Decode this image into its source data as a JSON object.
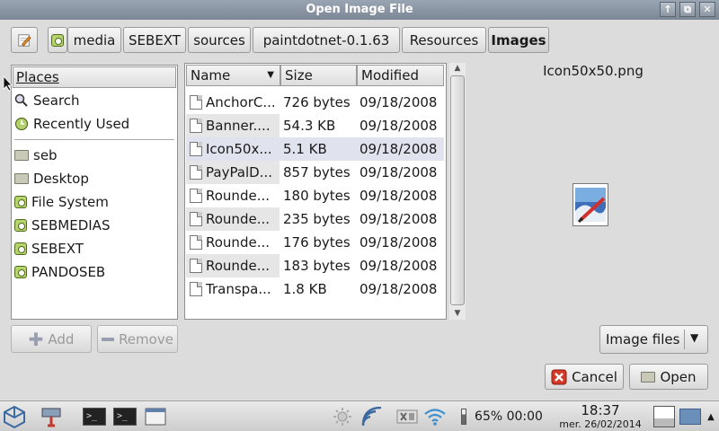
{
  "window": {
    "title": "Open Image File",
    "controls": [
      "↑",
      "⧉",
      "✕"
    ]
  },
  "path": {
    "edit_icon": "pencil-icon",
    "root_icon": "drive-icon",
    "segments": [
      "media",
      "SEBEXT",
      "sources",
      "paintdotnet-0.1.63",
      "Resources",
      "Images"
    ]
  },
  "places": {
    "header": "Places",
    "shortcuts": [
      {
        "label": "Search",
        "icon": "search-icon"
      },
      {
        "label": "Recently Used",
        "icon": "recent-icon"
      }
    ],
    "bookmarks": [
      {
        "label": "seb",
        "icon": "folder-icon"
      },
      {
        "label": "Desktop",
        "icon": "folder-icon"
      },
      {
        "label": "File System",
        "icon": "drive-icon"
      },
      {
        "label": "SEBMEDIAS",
        "icon": "drive-icon"
      },
      {
        "label": "SEBEXT",
        "icon": "drive-icon"
      },
      {
        "label": "PANDOSEB",
        "icon": "drive-icon"
      }
    ],
    "add_label": "Add",
    "remove_label": "Remove"
  },
  "files": {
    "columns": {
      "name": "Name",
      "size": "Size",
      "modified": "Modified"
    },
    "rows": [
      {
        "name": "AnchorC...",
        "size": "726 bytes",
        "modified": "09/18/2008"
      },
      {
        "name": "Banner....",
        "size": "54.3 KB",
        "modified": "09/18/2008"
      },
      {
        "name": "Icon50x...",
        "size": "5.1 KB",
        "modified": "09/18/2008"
      },
      {
        "name": "PayPalD...",
        "size": "857 bytes",
        "modified": "09/18/2008"
      },
      {
        "name": "Rounde...",
        "size": "180 bytes",
        "modified": "09/18/2008"
      },
      {
        "name": "Rounde...",
        "size": "235 bytes",
        "modified": "09/18/2008"
      },
      {
        "name": "Rounde...",
        "size": "176 bytes",
        "modified": "09/18/2008"
      },
      {
        "name": "Rounde...",
        "size": "183 bytes",
        "modified": "09/18/2008"
      },
      {
        "name": "Transpa...",
        "size": "1.8 KB",
        "modified": "09/18/2008"
      }
    ],
    "selected_index": 2
  },
  "preview": {
    "filename": "Icon50x50.png"
  },
  "filter": {
    "value": "Image files"
  },
  "actions": {
    "cancel_label": "Cancel",
    "open_label": "Open"
  },
  "taskbar": {
    "battery": "65% 00:00",
    "time": "18:37",
    "date": "mer. 26/02/2014"
  },
  "colors": {
    "titlebar": "#8a95a3",
    "selection": "#e0e2ee",
    "cancel_icon": "#d23a2a"
  }
}
